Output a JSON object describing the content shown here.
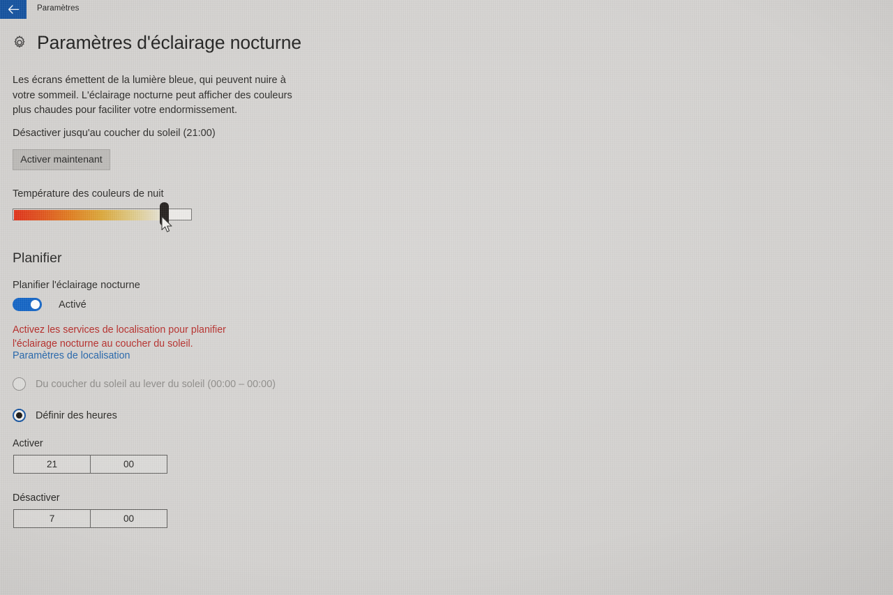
{
  "titlebar": {
    "back_icon": "arrow-left-icon",
    "title": "Paramètres",
    "back_color": "#12519f"
  },
  "header": {
    "icon": "gear-icon",
    "title": "Paramètres d'éclairage nocturne"
  },
  "main": {
    "description": "Les écrans émettent de la lumière bleue, qui peuvent nuire à votre sommeil. L'éclairage nocturne peut afficher des couleurs plus chaudes pour faciliter votre endormissement.",
    "sunset_note": "Désactiver jusqu'au coucher du soleil (21:00)",
    "activate_button": "Activer maintenant",
    "temperature_label": "Température des couleurs de nuit",
    "slider": {
      "value_percent": 85,
      "gradient_start": "#e02a12",
      "gradient_mid": "#dba430",
      "gradient_end": "#e9e6dc",
      "thumb_color": "#16120f"
    }
  },
  "schedule": {
    "heading": "Planifier",
    "toggle_label": "Planifier l'éclairage nocturne",
    "toggle_state_text": "Activé",
    "toggle_on": true,
    "toggle_color": "#0a5fc4",
    "warning_text": "Activez les services de localisation pour planifier l'éclairage nocturne au coucher du soleil.",
    "warning_color": "#b3221f",
    "location_link": "Paramètres de localisation",
    "link_color": "#1a5fa8",
    "options": [
      {
        "label": "Du coucher du soleil au lever du soleil (00:00 – 00:00)",
        "selected": false,
        "disabled": true
      },
      {
        "label": "Définir des heures",
        "selected": true,
        "disabled": false
      }
    ],
    "time_on": {
      "label": "Activer",
      "hours": "21",
      "minutes": "00"
    },
    "time_off": {
      "label": "Désactiver",
      "hours": "7",
      "minutes": "00"
    }
  },
  "cursor": {
    "icon": "mouse-pointer-icon"
  }
}
